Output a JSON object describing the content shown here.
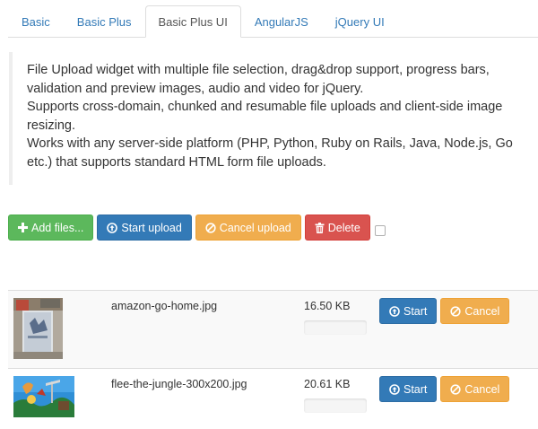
{
  "tabs": [
    {
      "label": "Basic",
      "active": false
    },
    {
      "label": "Basic Plus",
      "active": false
    },
    {
      "label": "Basic Plus UI",
      "active": true
    },
    {
      "label": "AngularJS",
      "active": false
    },
    {
      "label": "jQuery UI",
      "active": false
    }
  ],
  "description": {
    "line1": "File Upload widget with multiple file selection, drag&drop support, progress bars, validation and preview images, audio and video for jQuery.",
    "line2": "Supports cross-domain, chunked and resumable file uploads and client-side image resizing.",
    "line3": "Works with any server-side platform (PHP, Python, Ruby on Rails, Java, Node.js, Go etc.) that supports standard HTML form file uploads."
  },
  "toolbar": {
    "add_label": "Add files...",
    "start_label": "Start upload",
    "cancel_label": "Cancel upload",
    "delete_label": "Delete"
  },
  "files": [
    {
      "name": "amazon-go-home.jpg",
      "size": "16.50 KB",
      "progress": 0,
      "start_label": "Start",
      "cancel_label": "Cancel"
    },
    {
      "name": "flee-the-jungle-300x200.jpg",
      "size": "20.61 KB",
      "progress": 0,
      "start_label": "Start",
      "cancel_label": "Cancel"
    }
  ],
  "colors": {
    "link": "#337ab7",
    "success": "#5cb85c",
    "primary": "#337ab7",
    "warning": "#f0ad4e",
    "danger": "#d9534f"
  },
  "icons": {
    "add": "plus-icon",
    "start": "circle-arrow-up-icon",
    "cancel": "ban-circle-icon",
    "delete": "trash-icon"
  }
}
